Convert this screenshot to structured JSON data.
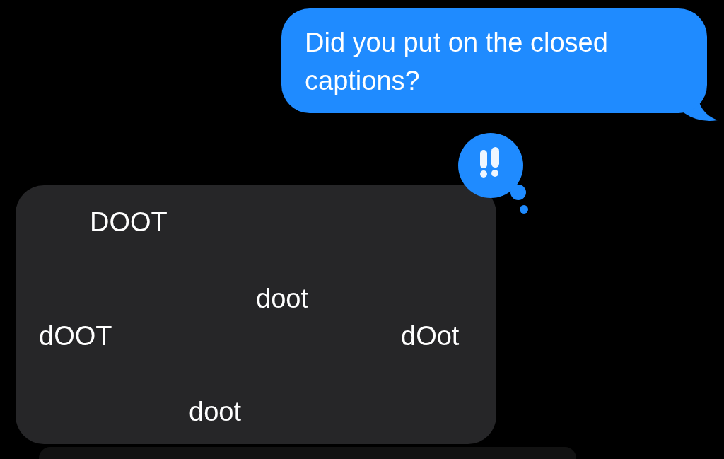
{
  "messages": [
    {
      "kind": "sent",
      "text": "Did you put on the closed captions?"
    },
    {
      "kind": "received",
      "emphasized": true,
      "words": [
        "DOOT",
        "doot",
        "dOOT",
        "dOot",
        "doot"
      ]
    }
  ]
}
